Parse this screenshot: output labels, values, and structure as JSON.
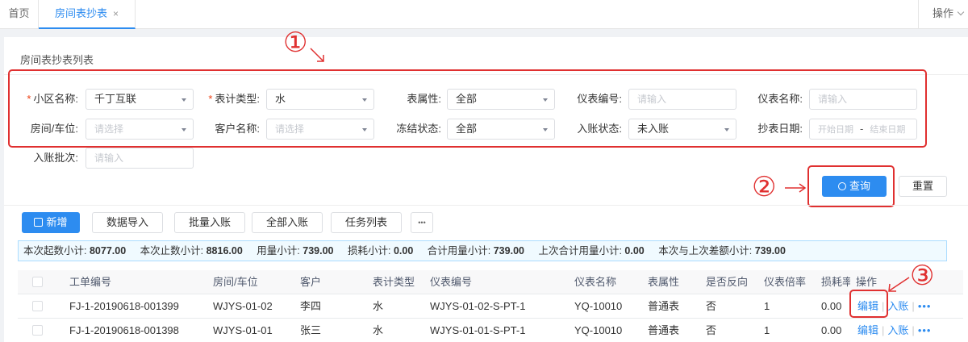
{
  "tabs": {
    "home": "首页",
    "active": "房间表抄表",
    "close": "×",
    "ops_menu": "操作"
  },
  "section_title": "房间表抄表列表",
  "filters": {
    "community_label": "小区名称:",
    "community_value": "千丁互联",
    "meter_type_label": "表计类型:",
    "meter_type_value": "水",
    "attr_label": "表属性:",
    "attr_value": "全部",
    "meter_no_label": "仪表编号:",
    "meter_no_placeholder": "请输入",
    "meter_name_label": "仪表名称:",
    "meter_name_placeholder": "请输入",
    "room_label": "房间/车位:",
    "room_placeholder": "请选择",
    "customer_label": "客户名称:",
    "customer_placeholder": "请选择",
    "freeze_label": "冻结状态:",
    "freeze_value": "全部",
    "post_label": "入账状态:",
    "post_value": "未入账",
    "date_label": "抄表日期:",
    "date_start": "开始日期",
    "date_sep": "-",
    "date_end": "结束日期",
    "batch_label": "入账批次:",
    "batch_placeholder": "请输入"
  },
  "buttons": {
    "query": "查询",
    "reset": "重置",
    "add": "新增",
    "import": "数据导入",
    "batch_post": "批量入账",
    "post_all": "全部入账",
    "task_list": "任务列表",
    "more": "•••"
  },
  "annotations": {
    "one": "①",
    "two": "②",
    "three": "③"
  },
  "summary": [
    {
      "label": "本次起数小计:",
      "value": "8077.00"
    },
    {
      "label": "本次止数小计:",
      "value": "8816.00"
    },
    {
      "label": "用量小计:",
      "value": "739.00"
    },
    {
      "label": "损耗小计:",
      "value": "0.00"
    },
    {
      "label": "合计用量小计:",
      "value": "739.00"
    },
    {
      "label": "上次合计用量小计:",
      "value": "0.00"
    },
    {
      "label": "本次与上次差额小计:",
      "value": "739.00"
    }
  ],
  "table": {
    "headers": [
      "工单编号",
      "房间/车位",
      "客户",
      "表计类型",
      "仪表编号",
      "仪表名称",
      "表属性",
      "是否反向",
      "仪表倍率",
      "损耗率",
      "操作"
    ],
    "rows": [
      [
        "FJ-1-20190618-001399",
        "WJYS-01-02",
        "李四",
        "水",
        "WJYS-01-02-S-PT-1",
        "YQ-10010",
        "普通表",
        "否",
        "1",
        "0.00"
      ],
      [
        "FJ-1-20190618-001398",
        "WJYS-01-01",
        "张三",
        "水",
        "WJYS-01-01-S-PT-1",
        "YQ-10010",
        "普通表",
        "否",
        "1",
        "0.00"
      ]
    ],
    "op_edit": "编辑",
    "op_post": "入账",
    "op_div": "|",
    "op_more": "•••"
  },
  "colors": {
    "primary": "#2d8cf0",
    "annotation": "#e03030",
    "required": "#ed4014"
  }
}
